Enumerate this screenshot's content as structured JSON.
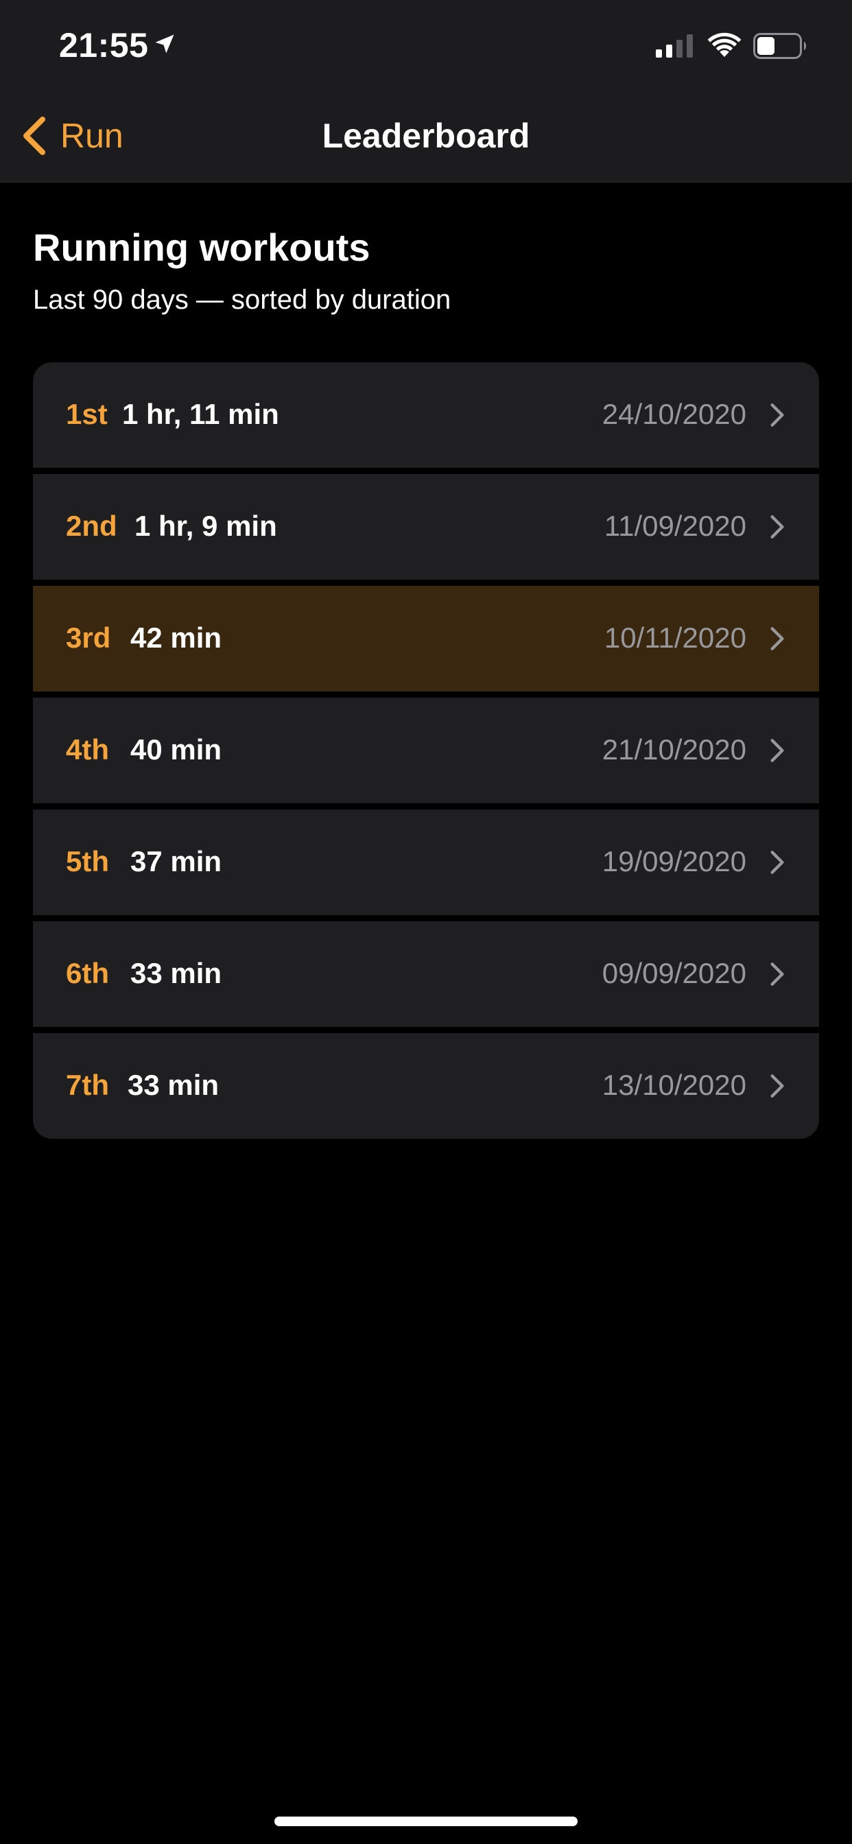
{
  "status_bar": {
    "time": "21:55",
    "icons": [
      "location-arrow-icon",
      "cellular-signal-icon",
      "wifi-icon",
      "battery-icon"
    ]
  },
  "nav": {
    "back_label": "Run",
    "title": "Leaderboard",
    "accent_color": "#f5a43c"
  },
  "header": {
    "title": "Running workouts",
    "subtitle": "Last 90 days — sorted by duration"
  },
  "workouts": [
    {
      "rank": "1st",
      "duration": "1 hr, 11 min",
      "date": "24/10/2020",
      "highlighted": false
    },
    {
      "rank": "2nd",
      "duration": "1 hr, 9 min",
      "date": "11/09/2020",
      "highlighted": false
    },
    {
      "rank": "3rd",
      "duration": "42 min",
      "date": "10/11/2020",
      "highlighted": true
    },
    {
      "rank": "4th",
      "duration": "40 min",
      "date": "21/10/2020",
      "highlighted": false
    },
    {
      "rank": "5th",
      "duration": "37 min",
      "date": "19/09/2020",
      "highlighted": false
    },
    {
      "rank": "6th",
      "duration": "33 min",
      "date": "09/09/2020",
      "highlighted": false
    },
    {
      "rank": "7th",
      "duration": "33 min",
      "date": "13/10/2020",
      "highlighted": false
    }
  ],
  "colors": {
    "background": "#000000",
    "bar": "#1c1c1e",
    "row": "#1f1f21",
    "row_highlight": "#3a2710",
    "rank": "#f5a43c",
    "date": "#98989d"
  }
}
